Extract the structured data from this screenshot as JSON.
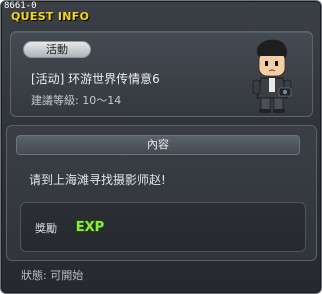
{
  "debug_id": "8661-0",
  "window": {
    "title": "QUEST INFO"
  },
  "quest": {
    "category": "活動",
    "name": "[活动] 环游世界传情意6",
    "level_text": "建議等級: 10～14"
  },
  "content": {
    "header": "內容",
    "description": "请到上海滩寻找摄影师赵!"
  },
  "reward": {
    "label": "獎勵",
    "exp_text": "EXP"
  },
  "status": {
    "text": "狀態: 可開始"
  },
  "colors": {
    "title": "#f5d41c",
    "exp_fill": "#8fea3a",
    "panel_bg": "#3a3f45"
  },
  "icons": {
    "npc": "npc-character-portrait",
    "exp": "exp-icon"
  }
}
